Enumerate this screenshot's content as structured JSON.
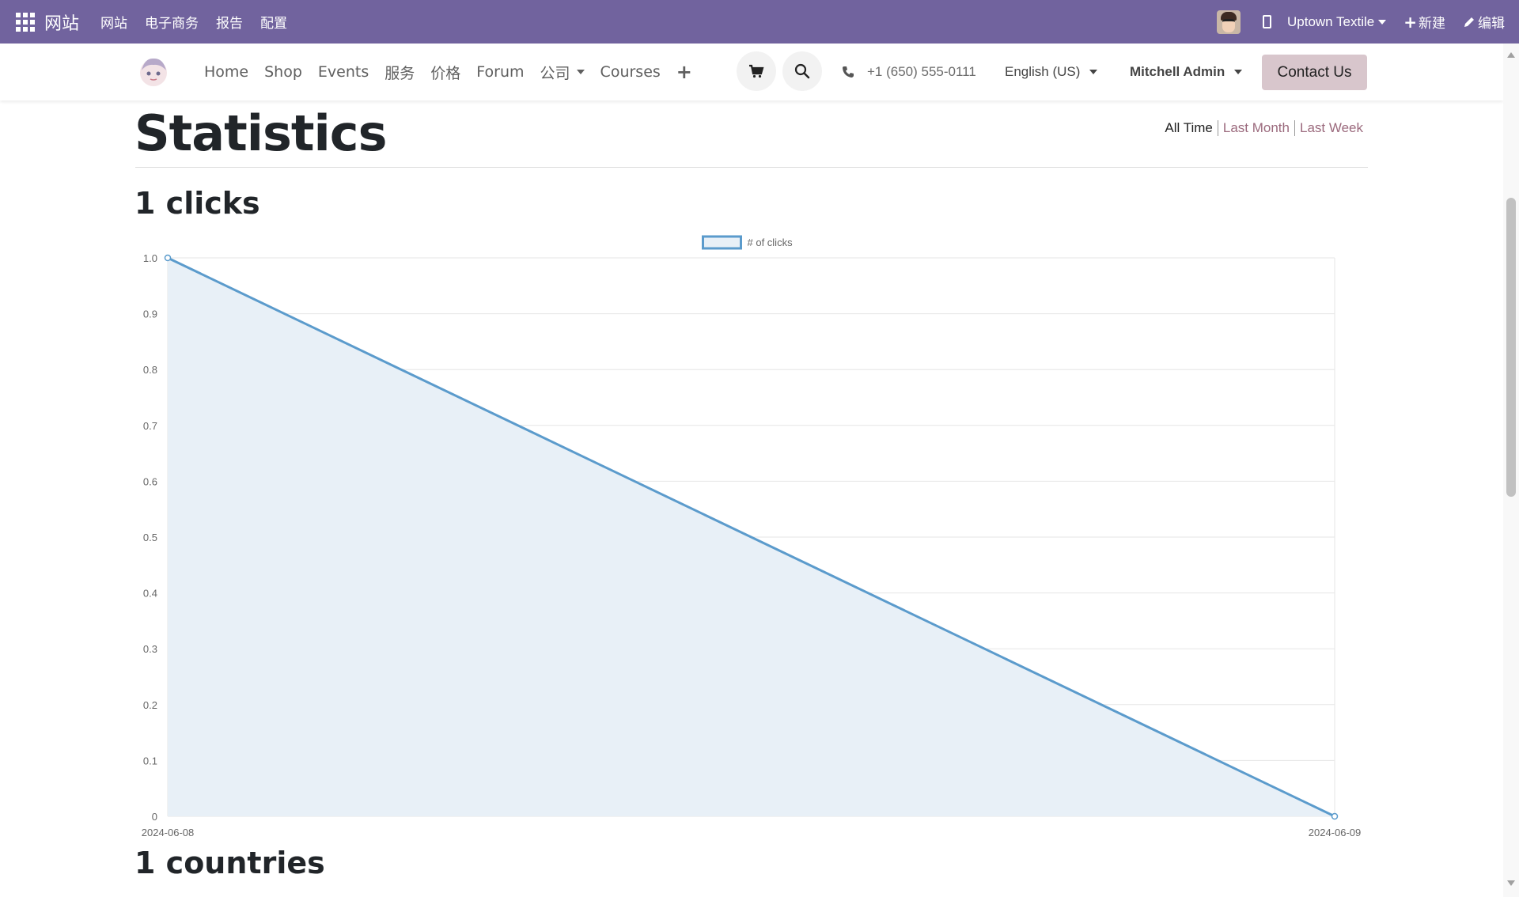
{
  "topbar": {
    "brand": "网站",
    "menu": [
      "网站",
      "电子商务",
      "报告",
      "配置"
    ],
    "site": "Uptown Textile",
    "new_label": "新建",
    "edit_label": "编辑"
  },
  "header": {
    "nav": [
      "Home",
      "Shop",
      "Events",
      "服务",
      "价格",
      "Forum"
    ],
    "nav_dropdown": "公司",
    "nav_after": "Courses",
    "phone": "+1 (650) 555-0111",
    "language": "English (US)",
    "user": "Mitchell Admin",
    "contact": "Contact Us"
  },
  "page": {
    "title": "Statistics",
    "filters": {
      "all": "All Time",
      "month": "Last Month",
      "week": "Last Week"
    },
    "clicks_heading": "1 clicks",
    "countries_heading": "1 countries"
  },
  "colors": {
    "admin_bar": "#71639e",
    "line": "#5b9bcc",
    "fill": "#e8f0f7",
    "link": "#9b6a7d",
    "contact_bg": "#d8c6cc"
  },
  "chart_data": {
    "type": "area",
    "x": [
      "2024-06-08",
      "2024-06-09"
    ],
    "series": [
      {
        "name": "# of clicks",
        "values": [
          1,
          0
        ]
      }
    ],
    "ylim": [
      0,
      1
    ],
    "yticks": [
      "0",
      "0.1",
      "0.2",
      "0.3",
      "0.4",
      "0.5",
      "0.6",
      "0.7",
      "0.8",
      "0.9",
      "1.0"
    ],
    "legend": "top-center",
    "grid": true
  }
}
